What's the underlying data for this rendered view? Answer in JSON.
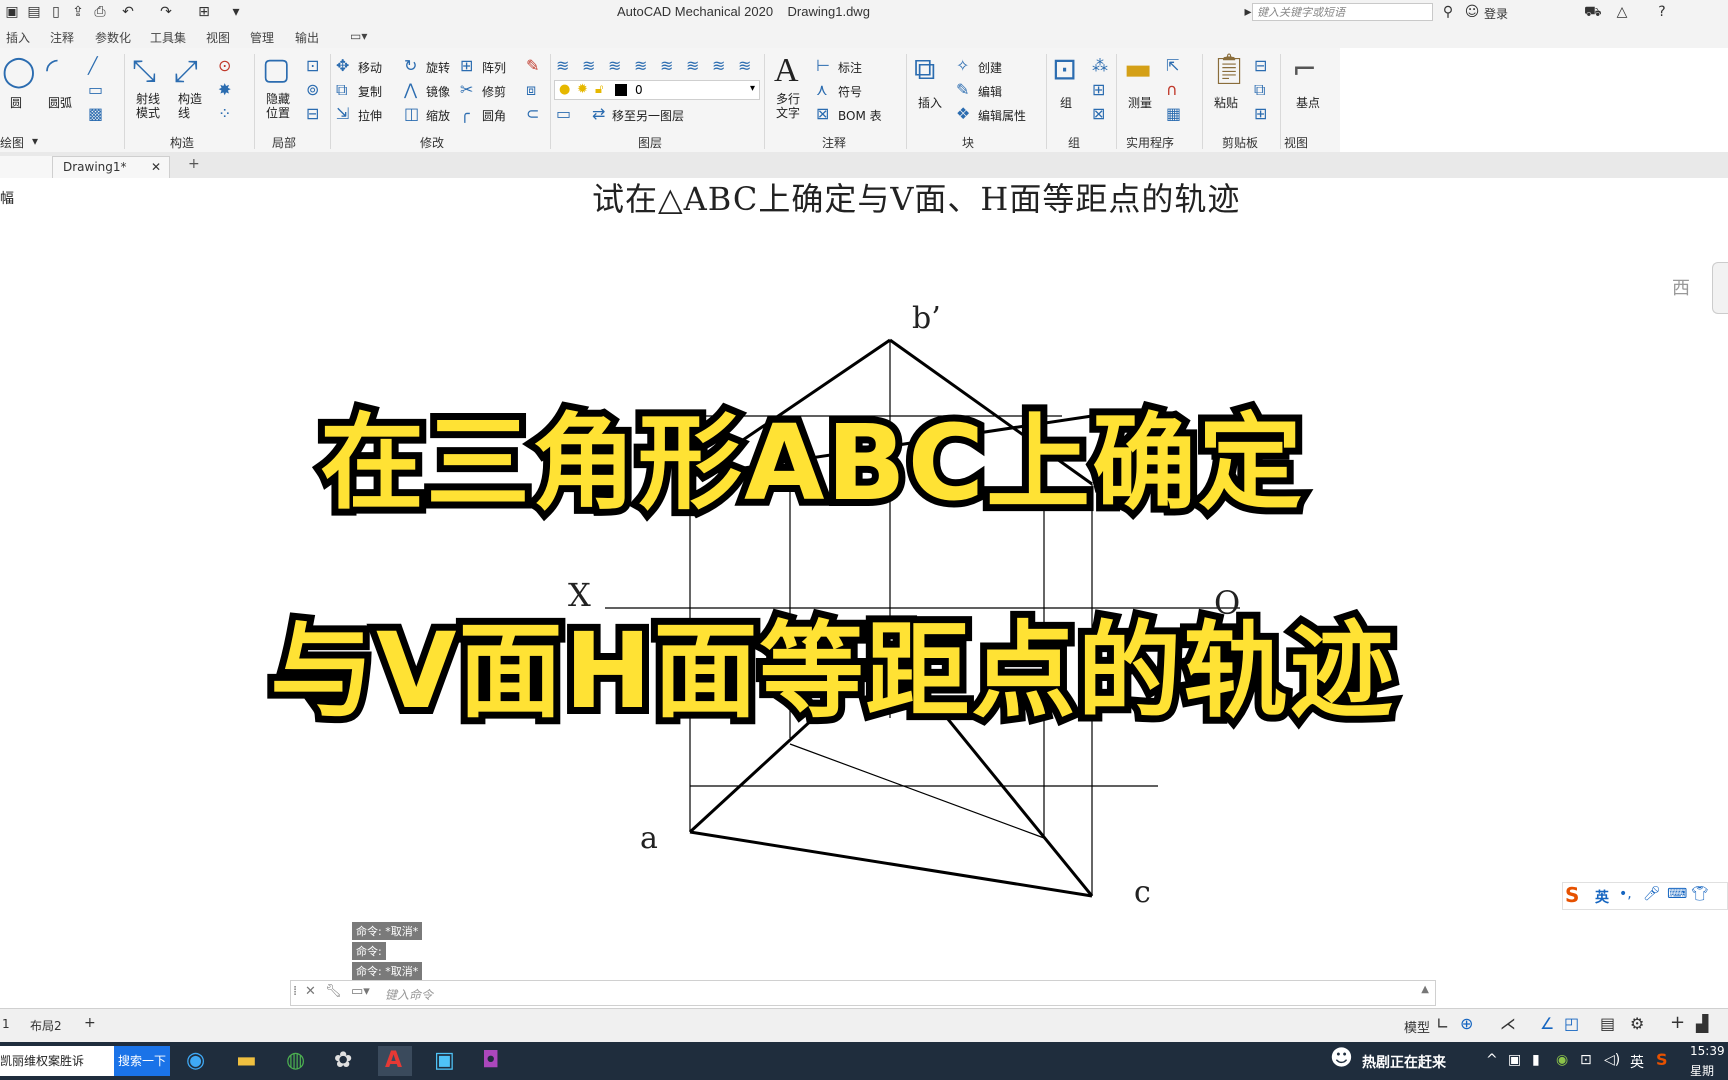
{
  "window": {
    "title": "AutoCAD Mechanical 2020",
    "filename": "Drawing1.dwg",
    "search_placeholder": "键入关键字或短语",
    "login": "登录"
  },
  "menu": [
    "插入",
    "注释",
    "参数化",
    "工具集",
    "视图",
    "管理",
    "输出"
  ],
  "ribbon": {
    "panels": [
      {
        "label": "绘图"
      },
      {
        "label": "构造"
      },
      {
        "label": "局部"
      },
      {
        "label": "修改"
      },
      {
        "label": "图层"
      },
      {
        "label": "注释"
      },
      {
        "label": "块"
      },
      {
        "label": "组"
      },
      {
        "label": "实用程序"
      },
      {
        "label": "剪贴板"
      },
      {
        "label": "视图"
      }
    ],
    "draw": {
      "circle": "圆",
      "arc": "圆弧"
    },
    "construct": {
      "ray": "射线\n模式",
      "xline": "构造\n线"
    },
    "detail": {
      "hide": "隐藏\n位置"
    },
    "modify": {
      "move": "移动",
      "rotate": "旋转",
      "array": "阵列",
      "copy": "复制",
      "mirror": "镜像",
      "trim": "修剪",
      "stretch": "拉伸",
      "scale": "缩放",
      "fillet": "圆角"
    },
    "layer": {
      "current": "0",
      "move_to_layer": "移至另一图层"
    },
    "annotation": {
      "mtext": "多行\n文字",
      "dimension": "标注",
      "symbol": "符号",
      "bom": "BOM 表"
    },
    "block": {
      "insert": "插入",
      "create": "创建",
      "edit": "编辑",
      "edit_attr": "编辑属性"
    },
    "group": {
      "group": "组"
    },
    "utilities": {
      "measure": "测量"
    },
    "clipboard": {
      "paste": "粘贴"
    },
    "view": {
      "base": "基点"
    }
  },
  "tabs": {
    "doc": "Drawing1*",
    "close": "✕",
    "add": "+"
  },
  "canvas": {
    "side_label": "幅",
    "heading": "试在△ABC上确定与V面、H面等距点的轨迹",
    "label_b": "b’",
    "label_a": "a",
    "label_c": "c",
    "label_x": "X",
    "label_o": "O",
    "right_note": "西",
    "overlay_line1": "在三角形ABC上确定",
    "overlay_line2": "与V面H面等距点的轨迹"
  },
  "command": {
    "history": [
      "命令: *取消*",
      "命令:",
      "命令: *取消*"
    ],
    "placeholder": "键入命令"
  },
  "status": {
    "layout_tab_1": "1",
    "layout_tab_2": "布局2",
    "model": "模型"
  },
  "ime": {
    "lang": "英"
  },
  "taskbar": {
    "search_text": "凯丽维权案胜诉",
    "search_button": "搜索一下",
    "news": "热剧正在赶来",
    "lang": "英",
    "time": "15:39",
    "weekday": "星期"
  }
}
